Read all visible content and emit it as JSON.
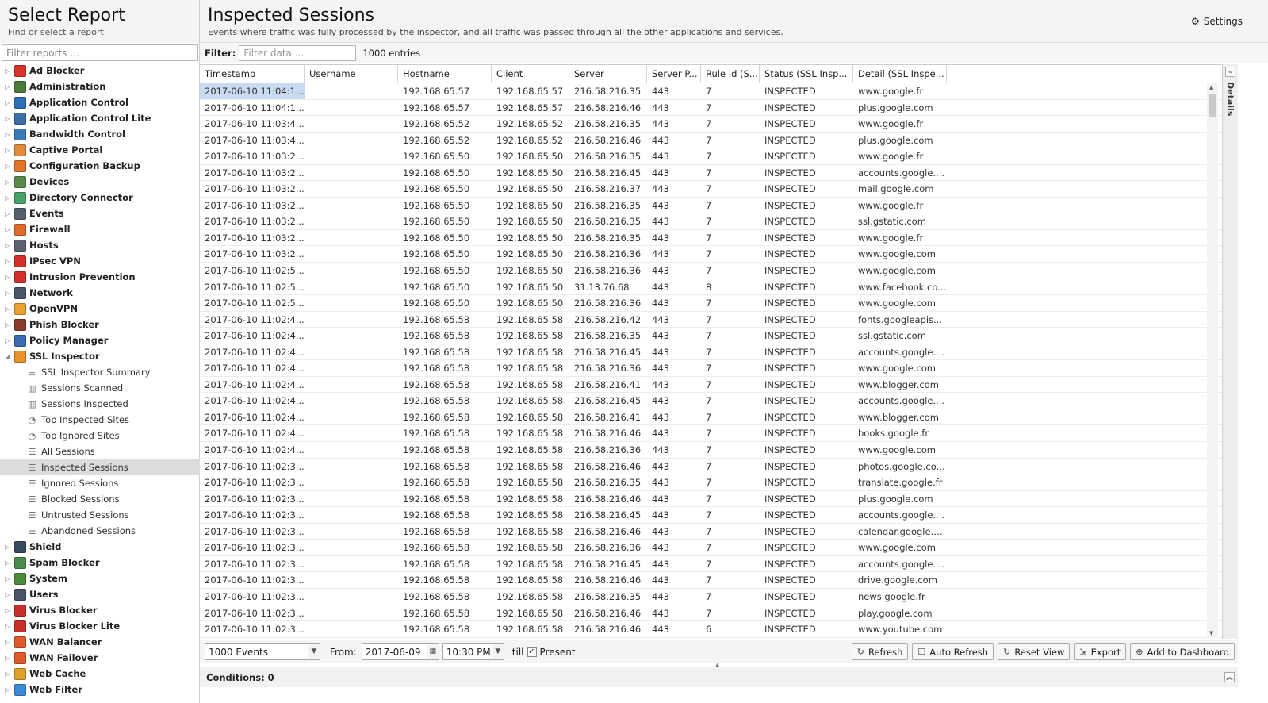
{
  "left": {
    "title": "Select Report",
    "subtitle": "Find or select a report",
    "filter_placeholder": "Filter reports ...",
    "tree_before": [
      {
        "label": "Ad Blocker",
        "color": "#d9342b"
      },
      {
        "label": "Administration",
        "color": "#4a7a3a"
      },
      {
        "label": "Application Control",
        "color": "#2e6fb5"
      },
      {
        "label": "Application Control Lite",
        "color": "#3c6fa8"
      },
      {
        "label": "Bandwidth Control",
        "color": "#3a7ab8"
      },
      {
        "label": "Captive Portal",
        "color": "#e08a3c"
      },
      {
        "label": "Configuration Backup",
        "color": "#e0762a"
      },
      {
        "label": "Devices",
        "color": "#5a8a4a"
      },
      {
        "label": "Directory Connector",
        "color": "#4aa06a"
      },
      {
        "label": "Events",
        "color": "#555f6e"
      },
      {
        "label": "Firewall",
        "color": "#e06a2a"
      },
      {
        "label": "Hosts",
        "color": "#5b6270"
      },
      {
        "label": "IPsec VPN",
        "color": "#d4302b"
      },
      {
        "label": "Intrusion Prevention",
        "color": "#d4302b"
      },
      {
        "label": "Network",
        "color": "#4a5566"
      },
      {
        "label": "OpenVPN",
        "color": "#e8a030"
      },
      {
        "label": "Phish Blocker",
        "color": "#8a3a2a"
      },
      {
        "label": "Policy Manager",
        "color": "#3a6ab0"
      }
    ],
    "expanded": {
      "label": "SSL Inspector",
      "color": "#e8902a"
    },
    "children": [
      {
        "label": "SSL Inspector Summary",
        "icon": "≡"
      },
      {
        "label": "Sessions Scanned",
        "icon": "▥"
      },
      {
        "label": "Sessions Inspected",
        "icon": "▥"
      },
      {
        "label": "Top Inspected Sites",
        "icon": "◔"
      },
      {
        "label": "Top Ignored Sites",
        "icon": "◔"
      },
      {
        "label": "All Sessions",
        "icon": "☰"
      },
      {
        "label": "Inspected Sessions",
        "icon": "☰"
      },
      {
        "label": "Ignored Sessions",
        "icon": "☰"
      },
      {
        "label": "Blocked Sessions",
        "icon": "☰"
      },
      {
        "label": "Untrusted Sessions",
        "icon": "☰"
      },
      {
        "label": "Abandoned Sessions",
        "icon": "☰"
      }
    ],
    "tree_after": [
      {
        "label": "Shield",
        "color": "#3a4a5e"
      },
      {
        "label": "Spam Blocker",
        "color": "#4a8a4a"
      },
      {
        "label": "System",
        "color": "#4a8a3a"
      },
      {
        "label": "Users",
        "color": "#4a5566"
      },
      {
        "label": "Virus Blocker",
        "color": "#c8302b"
      },
      {
        "label": "Virus Blocker Lite",
        "color": "#c8302b"
      },
      {
        "label": "WAN Balancer",
        "color": "#e05a2a"
      },
      {
        "label": "WAN Failover",
        "color": "#e05a2a"
      },
      {
        "label": "Web Cache",
        "color": "#e0a02a"
      },
      {
        "label": "Web Filter",
        "color": "#3a8ad8"
      }
    ]
  },
  "main": {
    "title": "Inspected Sessions",
    "subtitle": "Events where traffic was fully processed by the inspector, and all traffic was passed through all the other applications and services.",
    "settings_label": "Settings",
    "filter_label": "Filter:",
    "filter_placeholder": "Filter data ...",
    "entries": "1000 entries",
    "columns": [
      "Timestamp",
      "Username",
      "Hostname",
      "Client",
      "Server",
      "Server P...",
      "Rule Id (S...",
      "Status (SSL Insp...",
      "Detail (SSL Inspe..."
    ],
    "rows": [
      [
        "2017-06-10 11:04:1...",
        "",
        "192.168.65.57",
        "192.168.65.57",
        "216.58.216.35",
        "443",
        "7",
        "INSPECTED",
        "www.google.fr"
      ],
      [
        "2017-06-10 11:04:1...",
        "",
        "192.168.65.57",
        "192.168.65.57",
        "216.58.216.46",
        "443",
        "7",
        "INSPECTED",
        "plus.google.com"
      ],
      [
        "2017-06-10 11:03:4...",
        "",
        "192.168.65.52",
        "192.168.65.52",
        "216.58.216.35",
        "443",
        "7",
        "INSPECTED",
        "www.google.fr"
      ],
      [
        "2017-06-10 11:03:4...",
        "",
        "192.168.65.52",
        "192.168.65.52",
        "216.58.216.46",
        "443",
        "7",
        "INSPECTED",
        "plus.google.com"
      ],
      [
        "2017-06-10 11:03:2...",
        "",
        "192.168.65.50",
        "192.168.65.50",
        "216.58.216.35",
        "443",
        "7",
        "INSPECTED",
        "www.google.fr"
      ],
      [
        "2017-06-10 11:03:2...",
        "",
        "192.168.65.50",
        "192.168.65.50",
        "216.58.216.45",
        "443",
        "7",
        "INSPECTED",
        "accounts.google...."
      ],
      [
        "2017-06-10 11:03:2...",
        "",
        "192.168.65.50",
        "192.168.65.50",
        "216.58.216.37",
        "443",
        "7",
        "INSPECTED",
        "mail.google.com"
      ],
      [
        "2017-06-10 11:03:2...",
        "",
        "192.168.65.50",
        "192.168.65.50",
        "216.58.216.35",
        "443",
        "7",
        "INSPECTED",
        "www.google.fr"
      ],
      [
        "2017-06-10 11:03:2...",
        "",
        "192.168.65.50",
        "192.168.65.50",
        "216.58.216.35",
        "443",
        "7",
        "INSPECTED",
        "ssl.gstatic.com"
      ],
      [
        "2017-06-10 11:03:2...",
        "",
        "192.168.65.50",
        "192.168.65.50",
        "216.58.216.35",
        "443",
        "7",
        "INSPECTED",
        "www.google.fr"
      ],
      [
        "2017-06-10 11:03:2...",
        "",
        "192.168.65.50",
        "192.168.65.50",
        "216.58.216.36",
        "443",
        "7",
        "INSPECTED",
        "www.google.com"
      ],
      [
        "2017-06-10 11:02:5...",
        "",
        "192.168.65.50",
        "192.168.65.50",
        "216.58.216.36",
        "443",
        "7",
        "INSPECTED",
        "www.google.com"
      ],
      [
        "2017-06-10 11:02:5...",
        "",
        "192.168.65.50",
        "192.168.65.50",
        "31.13.76.68",
        "443",
        "8",
        "INSPECTED",
        "www.facebook.co..."
      ],
      [
        "2017-06-10 11:02:5...",
        "",
        "192.168.65.50",
        "192.168.65.50",
        "216.58.216.36",
        "443",
        "7",
        "INSPECTED",
        "www.google.com"
      ],
      [
        "2017-06-10 11:02:4...",
        "",
        "192.168.65.58",
        "192.168.65.58",
        "216.58.216.42",
        "443",
        "7",
        "INSPECTED",
        "fonts.googleapis..."
      ],
      [
        "2017-06-10 11:02:4...",
        "",
        "192.168.65.58",
        "192.168.65.58",
        "216.58.216.35",
        "443",
        "7",
        "INSPECTED",
        "ssl.gstatic.com"
      ],
      [
        "2017-06-10 11:02:4...",
        "",
        "192.168.65.58",
        "192.168.65.58",
        "216.58.216.45",
        "443",
        "7",
        "INSPECTED",
        "accounts.google...."
      ],
      [
        "2017-06-10 11:02:4...",
        "",
        "192.168.65.58",
        "192.168.65.58",
        "216.58.216.36",
        "443",
        "7",
        "INSPECTED",
        "www.google.com"
      ],
      [
        "2017-06-10 11:02:4...",
        "",
        "192.168.65.58",
        "192.168.65.58",
        "216.58.216.41",
        "443",
        "7",
        "INSPECTED",
        "www.blogger.com"
      ],
      [
        "2017-06-10 11:02:4...",
        "",
        "192.168.65.58",
        "192.168.65.58",
        "216.58.216.45",
        "443",
        "7",
        "INSPECTED",
        "accounts.google...."
      ],
      [
        "2017-06-10 11:02:4...",
        "",
        "192.168.65.58",
        "192.168.65.58",
        "216.58.216.41",
        "443",
        "7",
        "INSPECTED",
        "www.blogger.com"
      ],
      [
        "2017-06-10 11:02:4...",
        "",
        "192.168.65.58",
        "192.168.65.58",
        "216.58.216.46",
        "443",
        "7",
        "INSPECTED",
        "books.google.fr"
      ],
      [
        "2017-06-10 11:02:4...",
        "",
        "192.168.65.58",
        "192.168.65.58",
        "216.58.216.36",
        "443",
        "7",
        "INSPECTED",
        "www.google.com"
      ],
      [
        "2017-06-10 11:02:3...",
        "",
        "192.168.65.58",
        "192.168.65.58",
        "216.58.216.46",
        "443",
        "7",
        "INSPECTED",
        "photos.google.co..."
      ],
      [
        "2017-06-10 11:02:3...",
        "",
        "192.168.65.58",
        "192.168.65.58",
        "216.58.216.35",
        "443",
        "7",
        "INSPECTED",
        "translate.google.fr"
      ],
      [
        "2017-06-10 11:02:3...",
        "",
        "192.168.65.58",
        "192.168.65.58",
        "216.58.216.46",
        "443",
        "7",
        "INSPECTED",
        "plus.google.com"
      ],
      [
        "2017-06-10 11:02:3...",
        "",
        "192.168.65.58",
        "192.168.65.58",
        "216.58.216.45",
        "443",
        "7",
        "INSPECTED",
        "accounts.google...."
      ],
      [
        "2017-06-10 11:02:3...",
        "",
        "192.168.65.58",
        "192.168.65.58",
        "216.58.216.46",
        "443",
        "7",
        "INSPECTED",
        "calendar.google.c..."
      ],
      [
        "2017-06-10 11:02:3...",
        "",
        "192.168.65.58",
        "192.168.65.58",
        "216.58.216.36",
        "443",
        "7",
        "INSPECTED",
        "www.google.com"
      ],
      [
        "2017-06-10 11:02:3...",
        "",
        "192.168.65.58",
        "192.168.65.58",
        "216.58.216.45",
        "443",
        "7",
        "INSPECTED",
        "accounts.google...."
      ],
      [
        "2017-06-10 11:02:3...",
        "",
        "192.168.65.58",
        "192.168.65.58",
        "216.58.216.46",
        "443",
        "7",
        "INSPECTED",
        "drive.google.com"
      ],
      [
        "2017-06-10 11:02:3...",
        "",
        "192.168.65.58",
        "192.168.65.58",
        "216.58.216.35",
        "443",
        "7",
        "INSPECTED",
        "news.google.fr"
      ],
      [
        "2017-06-10 11:02:3...",
        "",
        "192.168.65.58",
        "192.168.65.58",
        "216.58.216.46",
        "443",
        "7",
        "INSPECTED",
        "play.google.com"
      ],
      [
        "2017-06-10 11:02:3...",
        "",
        "192.168.65.58",
        "192.168.65.58",
        "216.58.216.46",
        "443",
        "6",
        "INSPECTED",
        "www.youtube.com"
      ]
    ],
    "details_label": "Details"
  },
  "bottom": {
    "events_select": "1000 Events",
    "from_label": "From:",
    "from_date": "2017-06-09",
    "from_time": "10:30 PM",
    "till_label": "till",
    "present_checked": "✓",
    "present_label": "Present",
    "refresh": "Refresh",
    "auto_refresh": "Auto Refresh",
    "reset_view": "Reset View",
    "export": "Export",
    "add_to_dashboard": "Add to Dashboard",
    "conditions": "Conditions: 0"
  }
}
